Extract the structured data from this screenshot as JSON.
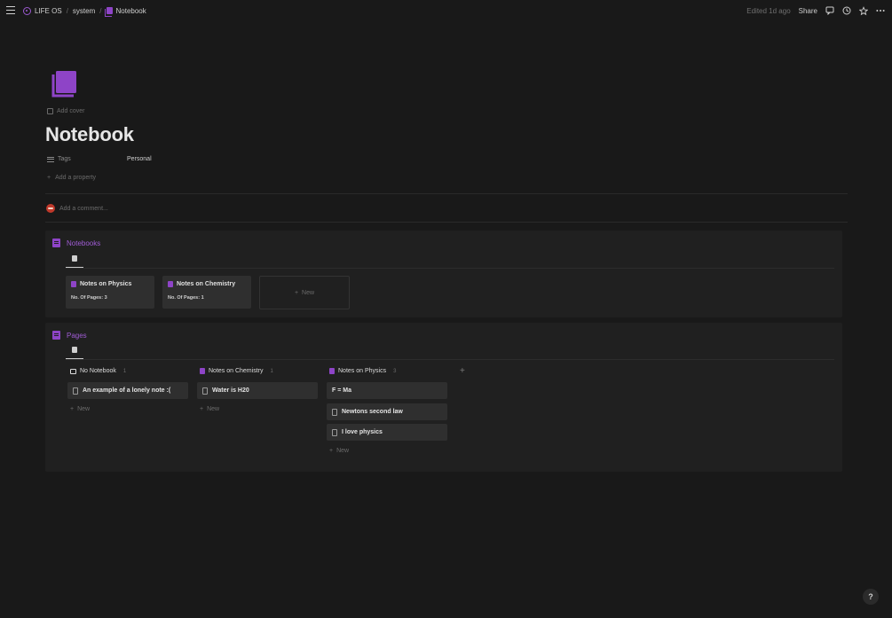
{
  "topbar": {
    "breadcrumbs": [
      "LIFE OS",
      "system",
      "Notebook"
    ],
    "separator": "/",
    "edited": "Edited 1d ago",
    "share": "Share"
  },
  "page": {
    "icon": "notebook-icon",
    "add_cover": "Add cover",
    "title": "Notebook",
    "properties": [
      {
        "name": "Tags",
        "value": "Personal"
      }
    ],
    "add_property": "Add a property",
    "comment_placeholder": "Add a comment..."
  },
  "notebooks": {
    "title": "Notebooks",
    "cards": [
      {
        "title": "Notes on Physics",
        "prop": "No. Of Pages: 3"
      },
      {
        "title": "Notes on Chemistry",
        "prop": "No. Of Pages: 1"
      }
    ],
    "new_label": "New"
  },
  "pages": {
    "title": "Pages",
    "groups": [
      {
        "name": "No Notebook",
        "count": "1",
        "cards": [
          "An example of a lonely note :("
        ],
        "new_label": "New"
      },
      {
        "name": "Notes on Chemistry",
        "count": "1",
        "cards": [
          "Water is H20"
        ],
        "new_label": "New"
      },
      {
        "name": "Notes on Physics",
        "count": "3",
        "cards": [
          "F = Ma",
          "Newtons second law",
          "I love physics"
        ],
        "new_label": "New"
      }
    ]
  },
  "help": "?",
  "colors": {
    "background": "#191919",
    "accent": "#9b59d0",
    "card": "#2f2f2f",
    "block": "#202020"
  }
}
